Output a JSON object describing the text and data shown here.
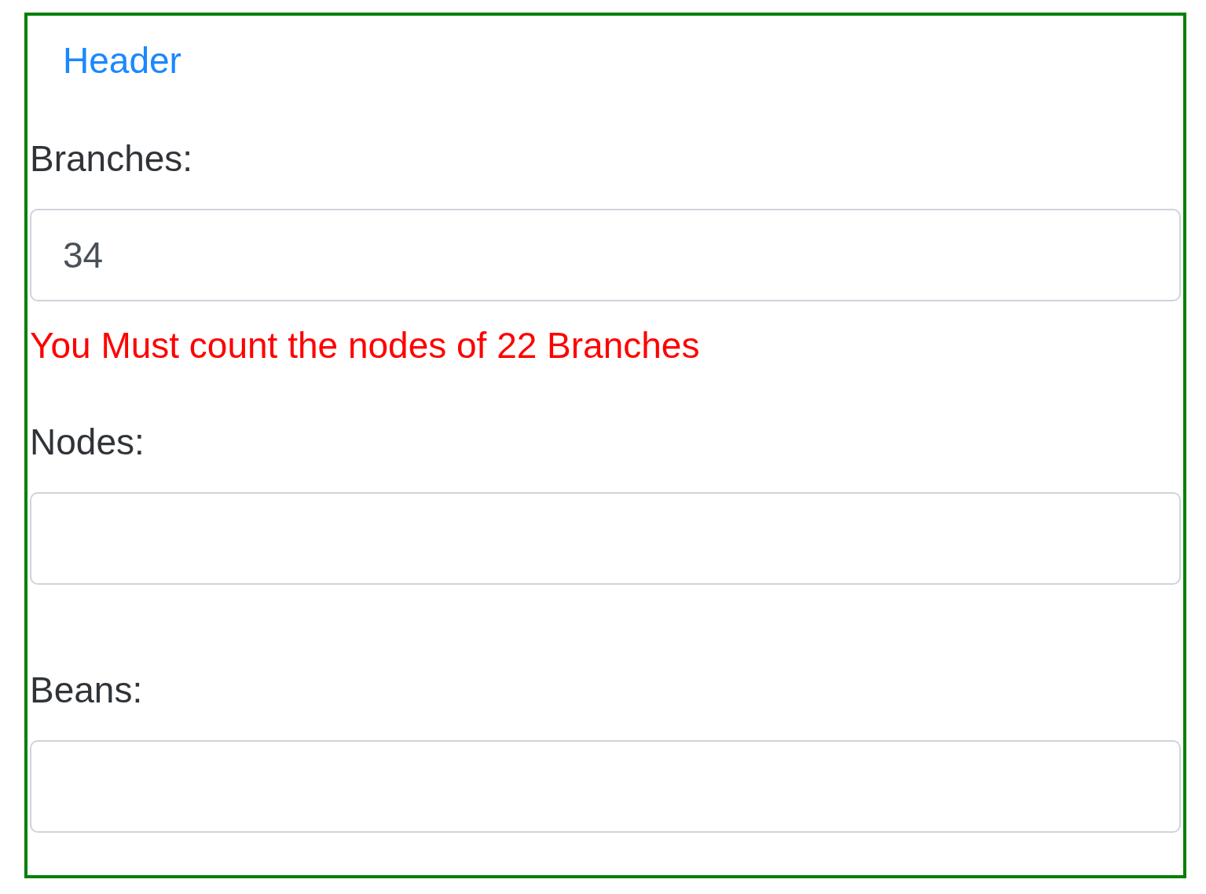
{
  "nav": {
    "link": "Header"
  },
  "fields": [
    {
      "label": "Branches:",
      "value": "34",
      "error": "You Must count the nodes of 22 Branches"
    },
    {
      "label": "Nodes:"
    },
    {
      "label": "Beans:"
    }
  ]
}
